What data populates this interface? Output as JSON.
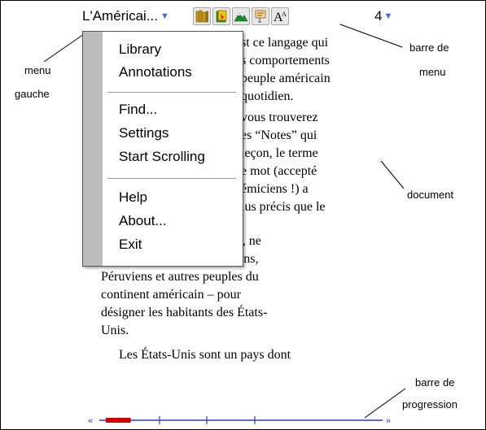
{
  "menubar": {
    "title": "L'Américai...",
    "title_caret": "▼",
    "tools": [
      "library-icon",
      "annotations-icon",
      "settings-icon",
      "bookmark-icon",
      "font-size-icon"
    ],
    "page": "4",
    "page_caret": "▼"
  },
  "menu": {
    "items": [
      "Library",
      "Annotations",
      "Find...",
      "Settings",
      "Start Scrolling",
      "Help",
      "About...",
      "Exit"
    ]
  },
  "document": {
    "visible_fragments": [
      "st ce langage qui",
      "s comportements",
      "peuple américain",
      "quotidien.",
      "vous trouverez",
      "es “Notes” qui",
      "leçon, le terme",
      "e mot (accepté",
      "émiciens !) a",
      "lus précis que le"
    ],
    "paragraph_1_rest": [
      "mot américain – applicable, ne",
      "l'oublions pas, aux Mexicains,",
      "Péruviens et autres peuples du",
      "continent américain – pour",
      "désigner les habitants des États-",
      "Unis."
    ],
    "paragraph_2": "Les États-Unis sont un pays dont"
  },
  "annotations": {
    "menu_gauche_1": "menu",
    "menu_gauche_2": "gauche",
    "barre_menu_1": "barre de",
    "barre_menu_2": "menu",
    "document": "document",
    "progression_1": "barre de",
    "progression_2": "progression"
  },
  "progress": {
    "prev": "«",
    "next": "»",
    "fraction": 0.09,
    "accent": "#d40000",
    "track_color": "#2a3bd0"
  }
}
